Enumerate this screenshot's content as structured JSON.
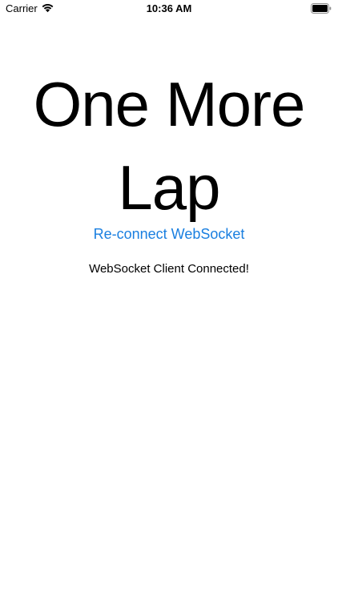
{
  "status_bar": {
    "carrier": "Carrier",
    "time": "10:36 AM",
    "wifi_icon": "wifi-icon",
    "battery_icon": "battery-icon"
  },
  "main": {
    "title": "One More Lap",
    "reconnect_label": "Re-connect WebSocket",
    "status_message": "WebSocket Client Connected!"
  },
  "colors": {
    "accent": "#1a7fe0",
    "text": "#000000",
    "background": "#ffffff"
  }
}
